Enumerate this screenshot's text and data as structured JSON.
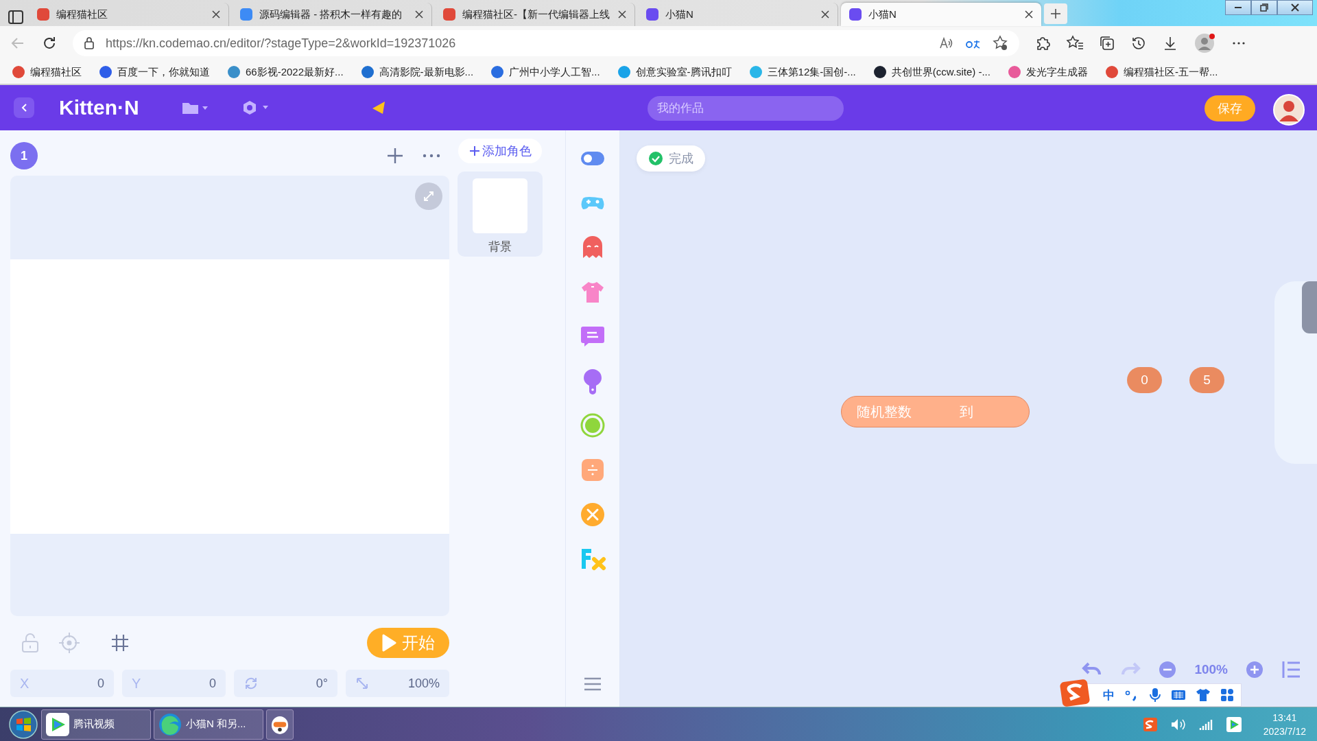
{
  "browser": {
    "tabs": [
      {
        "title": "编程猫社区",
        "selected": false,
        "kind": "community"
      },
      {
        "title": "源码编辑器 - 搭积木一样有趣的",
        "selected": false,
        "kind": "editor"
      },
      {
        "title": "编程猫社区-【新一代编辑器上线",
        "selected": false,
        "kind": "community"
      },
      {
        "title": "小猫N",
        "selected": false,
        "kind": "kitten"
      },
      {
        "title": "小猫N",
        "selected": true,
        "kind": "kitten"
      }
    ],
    "url": "https://kn.codemao.cn/editor/?stageType=2&workId=192371026",
    "bookmarks": [
      {
        "title": "编程猫社区",
        "color": "#e0493a"
      },
      {
        "title": "百度一下，你就知道",
        "color": "#2f5ee8"
      },
      {
        "title": "66影视-2022最新好...",
        "color": "#3a8fc9"
      },
      {
        "title": "高清影院-最新电影...",
        "color": "#1f6fd0"
      },
      {
        "title": "广州中小学人工智...",
        "color": "#2a6de0"
      },
      {
        "title": "创意实验室-腾讯扣叮",
        "color": "#1aa3e8"
      },
      {
        "title": "三体第12集-国创-...",
        "color": "#29b6e8"
      },
      {
        "title": "共创世界(ccw.site) -...",
        "color": "#1d2330"
      },
      {
        "title": "发光字生成器",
        "color": "#e85a9a"
      },
      {
        "title": "编程猫社区-五一帮...",
        "color": "#e0493a"
      }
    ]
  },
  "app": {
    "logo": "Kitten·N",
    "project_placeholder": "我的作品",
    "save_label": "保存"
  },
  "stage": {
    "scene_number": "1",
    "start_label": "开始",
    "fields": [
      {
        "kind": "x",
        "label": "X",
        "value": "0"
      },
      {
        "kind": "y",
        "label": "Y",
        "value": "0"
      },
      {
        "kind": "rotation",
        "value": "0°"
      },
      {
        "kind": "scale",
        "value": "100%"
      }
    ]
  },
  "sprites": {
    "add_label": "添加角色",
    "items": [
      {
        "name": "背景",
        "selected": false
      }
    ]
  },
  "workspace": {
    "done_label": "完成",
    "block": {
      "text": "随机整数",
      "joiner": "到"
    },
    "number_slots": [
      "0",
      "5"
    ],
    "zoom": "100%"
  },
  "ime": {
    "mode": "中"
  },
  "taskbar": {
    "buttons": [
      {
        "label": "腾讯视频",
        "kind": "video"
      },
      {
        "label": "小猫N 和另...",
        "kind": "edge"
      },
      {
        "kind": "app"
      }
    ],
    "time": "13:41",
    "date": "2023/7/12"
  }
}
